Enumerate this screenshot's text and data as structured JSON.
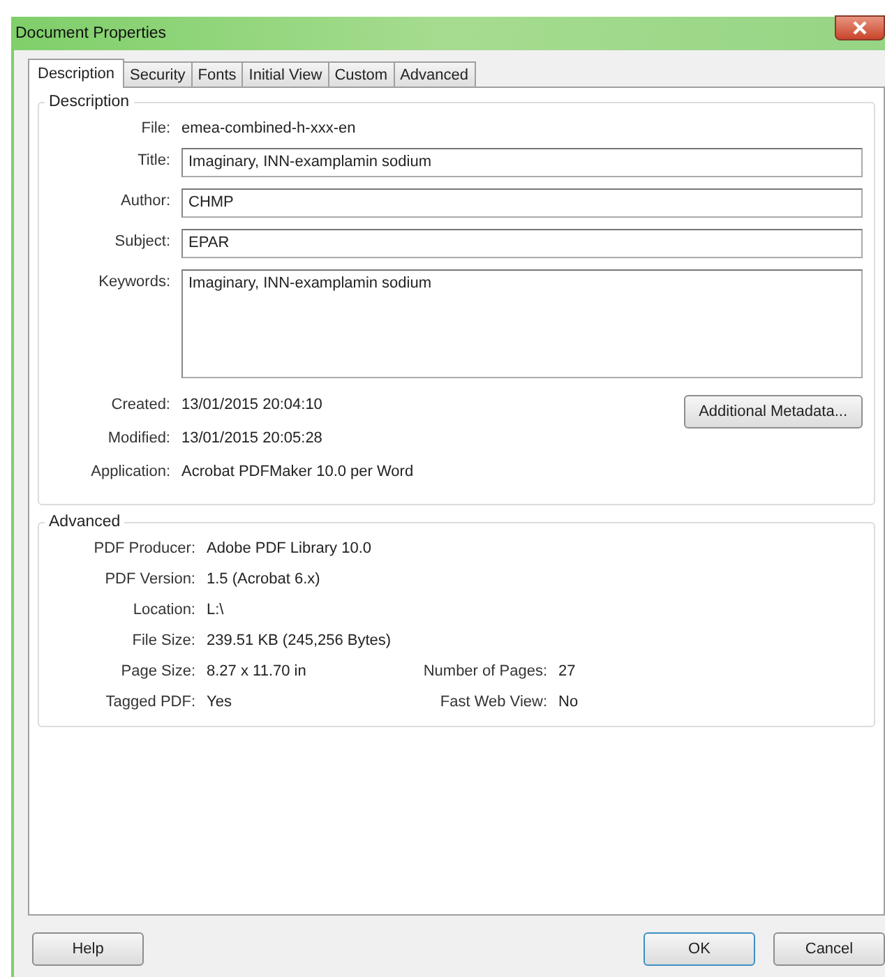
{
  "window": {
    "title": "Document Properties"
  },
  "tabs": [
    {
      "label": "Description",
      "selected": true
    },
    {
      "label": "Security",
      "selected": false
    },
    {
      "label": "Fonts",
      "selected": false
    },
    {
      "label": "Initial View",
      "selected": false
    },
    {
      "label": "Custom",
      "selected": false
    },
    {
      "label": "Advanced",
      "selected": false
    }
  ],
  "description": {
    "title": "Description",
    "rows": [
      {
        "kind": "text",
        "label": "File:",
        "value": "emea-combined-h-xxx-en"
      },
      {
        "kind": "input",
        "label": "Title:",
        "value": "Imaginary, INN-examplamin sodium"
      },
      {
        "kind": "input",
        "label": "Author:",
        "value": "CHMP"
      },
      {
        "kind": "input",
        "label": "Subject:",
        "value": "EPAR"
      },
      {
        "kind": "textarea",
        "label": "Keywords:",
        "value": "Imaginary, INN-examplamin sodium"
      }
    ],
    "dates": [
      {
        "label": "Created:",
        "value": "13/01/2015 20:04:10"
      },
      {
        "label": "Modified:",
        "value": "13/01/2015 20:05:28"
      },
      {
        "label": "Application:",
        "value": "Acrobat PDFMaker 10.0 per Word"
      }
    ],
    "metadata_button": "Additional Metadata..."
  },
  "advanced": {
    "title": "Advanced",
    "rows": [
      {
        "label": "PDF Producer:",
        "value": "Adobe PDF Library 10.0"
      },
      {
        "label": "PDF Version:",
        "value": "1.5 (Acrobat 6.x)"
      },
      {
        "label": "Location:",
        "value": "L:\\"
      },
      {
        "label": "File Size:",
        "value": "239.51 KB (245,256 Bytes)"
      },
      {
        "label": "Page Size:",
        "value": "8.27 x 11.70 in",
        "label_2": "Number of Pages:",
        "value_2": "27"
      },
      {
        "label": "Tagged PDF:",
        "value": "Yes",
        "label_2": "Fast Web View:",
        "value_2": "No"
      }
    ]
  },
  "buttons": [
    {
      "label": "Help",
      "kind": "normal"
    },
    {
      "label": "OK",
      "kind": "default"
    },
    {
      "label": "Cancel",
      "kind": "normal"
    }
  ]
}
